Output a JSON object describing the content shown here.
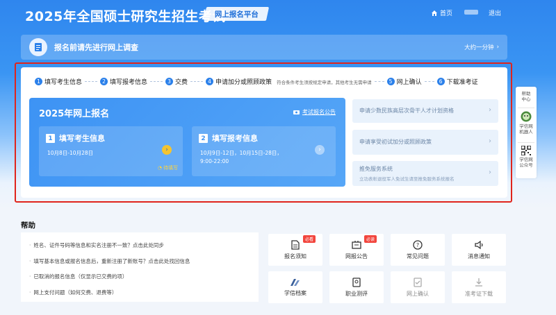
{
  "header": {
    "title": "2025年全国硕士研究生招生考试",
    "platform": "网上报名平台",
    "home": "首页",
    "logout": "退出"
  },
  "survey": {
    "text": "报名前请先进行网上调查",
    "time": "大约一分钟"
  },
  "steps": [
    {
      "num": "1",
      "label": "填写考生信息"
    },
    {
      "num": "2",
      "label": "填写报考信息"
    },
    {
      "num": "3",
      "label": "交费"
    },
    {
      "num": "4",
      "label": "申请加分或照顾政策",
      "note": "符合条件考生须按规定申请，其他考生无需申请"
    },
    {
      "num": "5",
      "label": "网上确认"
    },
    {
      "num": "6",
      "label": "下载准考证"
    }
  ],
  "registration": {
    "title": "2025年网上报名",
    "notice": "考试报名公告",
    "card1": {
      "num": "1",
      "title": "填写考生信息",
      "date": "10月8日-10月28日",
      "status": "待填写"
    },
    "card2": {
      "num": "2",
      "title": "填写报考信息",
      "date1": "10月9日-12日，10月15日-28日，",
      "date2": "9:00-22:00"
    }
  },
  "side_cards": [
    {
      "text": "申请少数民族高层次骨干人才计划资格"
    },
    {
      "text": "申请享受初试加分或照顾政策"
    },
    {
      "text": "推免服务系统",
      "sub": "立功表彰退役军人免试生请至推免服务系统报名"
    }
  ],
  "float_bar": {
    "help": [
      "帮助",
      "中心"
    ],
    "robot": [
      "学信网",
      "机器人"
    ],
    "wechat": [
      "学信网",
      "公众号"
    ]
  },
  "help": {
    "title": "帮助",
    "items": [
      "姓名、证件号码等信息和实名注册不一致？点击此处同步",
      "填写基本信息或报名信息后，重新注册了新账号？点击此处找回信息",
      "已取消的报名信息（仅显示已交费的项）",
      "网上支付问题（如何交费、退费等）"
    ]
  },
  "tiles": [
    {
      "label": "报名须知",
      "badge": "必看",
      "icon": "document-icon"
    },
    {
      "label": "网报公告",
      "badge": "必读",
      "icon": "notice-board-icon"
    },
    {
      "label": "常见问题",
      "icon": "question-icon"
    },
    {
      "label": "消息通知",
      "icon": "speaker-icon"
    },
    {
      "label": "学信档案",
      "icon": "archive-logo-icon"
    },
    {
      "label": "职业测评",
      "icon": "assessment-icon"
    },
    {
      "label": "网上确认",
      "icon": "confirm-icon"
    },
    {
      "label": "准考证下载",
      "icon": "download-icon"
    }
  ],
  "colors": {
    "primary": "#2b80ea",
    "highlight": "#e0241b",
    "badge": "#f2453d",
    "pending": "#ffd43b"
  }
}
